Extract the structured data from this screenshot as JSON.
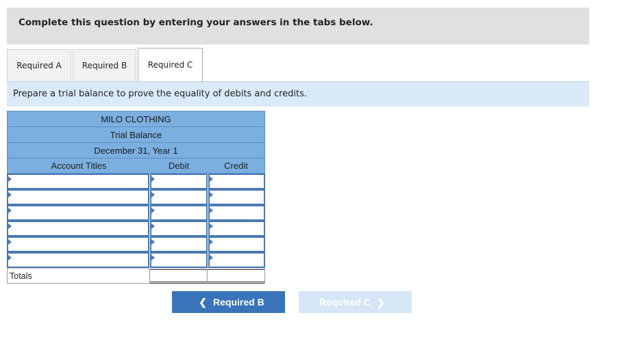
{
  "instructions": {
    "text": "Complete this question by entering your answers in the tabs below."
  },
  "tabs": [
    {
      "label": "Required A",
      "active": false
    },
    {
      "label": "Required B",
      "active": false
    },
    {
      "label": "Required C",
      "active": true
    }
  ],
  "prompt": {
    "text": "Prepare a trial balance to prove the equality of debits and credits."
  },
  "trial_balance": {
    "company": "MILO CLOTHING",
    "statement": "Trial Balance",
    "date": "December 31, Year 1",
    "columns": {
      "account": "Account Titles",
      "debit": "Debit",
      "credit": "Credit"
    },
    "rows": [
      {
        "account": "",
        "debit": "",
        "credit": ""
      },
      {
        "account": "",
        "debit": "",
        "credit": ""
      },
      {
        "account": "",
        "debit": "",
        "credit": ""
      },
      {
        "account": "",
        "debit": "",
        "credit": ""
      },
      {
        "account": "",
        "debit": "",
        "credit": ""
      },
      {
        "account": "",
        "debit": "",
        "credit": ""
      }
    ],
    "totals": {
      "label": "Totals",
      "debit": "",
      "credit": ""
    }
  },
  "navigation": {
    "prev_label": "Required B",
    "prev_icon": "chevron-left-icon",
    "next_label": "Required C",
    "next_icon": "chevron-right-icon"
  }
}
